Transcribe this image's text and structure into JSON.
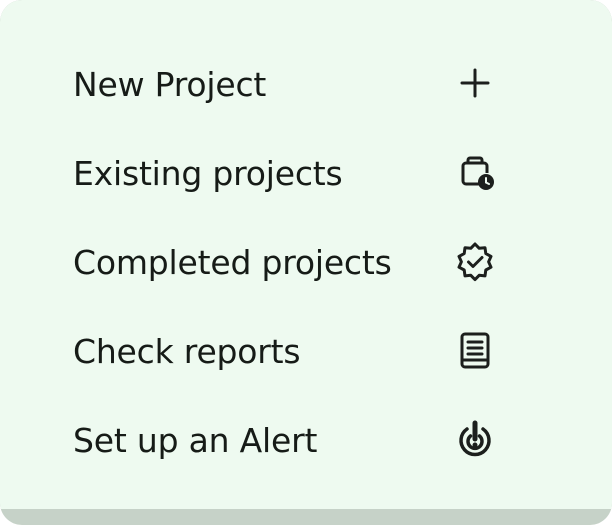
{
  "menu": {
    "items": [
      {
        "label": "New Project",
        "icon": "plus-icon"
      },
      {
        "label": "Existing projects",
        "icon": "briefcase-clock-icon"
      },
      {
        "label": "Completed projects",
        "icon": "verified-badge-icon"
      },
      {
        "label": "Check reports",
        "icon": "report-document-icon"
      },
      {
        "label": "Set up an Alert",
        "icon": "alert-target-icon"
      }
    ]
  },
  "colors": {
    "background": "#eefaf0",
    "text": "#161b17",
    "icon": "#1c1f1d",
    "bottom_strip": "#c6d2c8"
  }
}
